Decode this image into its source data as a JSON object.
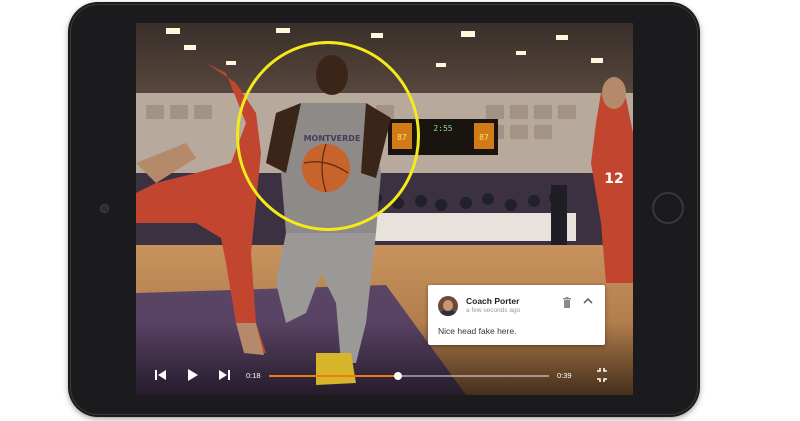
{
  "comment": {
    "author": "Coach Porter",
    "timestamp": "a few seconds ago",
    "text": "Nice head fake here."
  },
  "player": {
    "current_time": "0:18",
    "duration": "0:39",
    "progress": 0.46
  },
  "scene": {
    "jersey_text": "MONTVERDE",
    "scoreboard_time": "2:55",
    "left_score": "87",
    "right_score": "87",
    "opponent_number": "12"
  },
  "colors": {
    "highlight": "#f3ea1a",
    "progress": "#f07a18"
  },
  "icons": [
    "previous-icon",
    "play-icon",
    "next-icon",
    "fullscreen-icon",
    "trash-icon",
    "chevron-up-icon"
  ]
}
